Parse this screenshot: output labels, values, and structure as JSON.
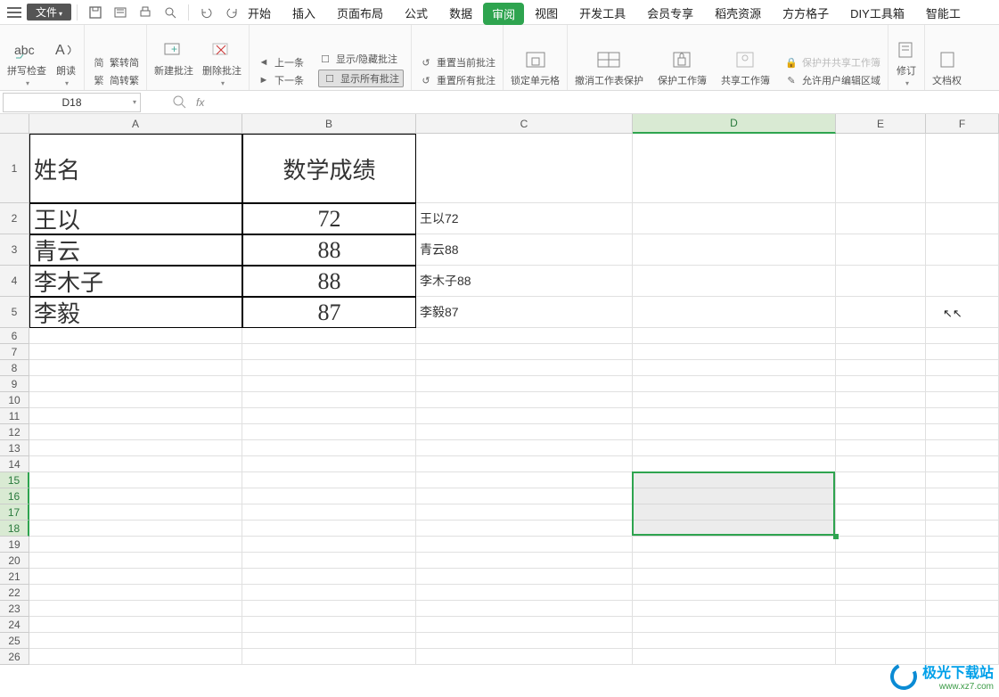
{
  "titlebar": {
    "file_label": "文件"
  },
  "ribbon_tabs": [
    "开始",
    "插入",
    "页面布局",
    "公式",
    "数据",
    "审阅",
    "视图",
    "开发工具",
    "会员专享",
    "稻壳资源",
    "方方格子",
    "DIY工具箱",
    "智能工"
  ],
  "ribbon_active_index": 5,
  "ribbon": {
    "spellcheck": "拼写检查",
    "readaloud": "朗读",
    "simp2trad": "繁转简",
    "trad2simp": "简转繁",
    "newcomment": "新建批注",
    "deletecomment": "删除批注",
    "prev": "上一条",
    "next": "下一条",
    "togglecomment": "显示/隐藏批注",
    "resetcurrent": "重置当前批注",
    "showall": "显示所有批注",
    "resetall": "重置所有批注",
    "lockcell": "锁定单元格",
    "unprotect": "撤消工作表保护",
    "protectbook": "保护工作簿",
    "sharebook": "共享工作簿",
    "protectshare": "保护并共享工作簿",
    "alloweditranges": "允许用户编辑区域",
    "revisions": "修订",
    "docauth": "文档权"
  },
  "namebox": "D18",
  "columns": [
    "A",
    "B",
    "C",
    "D",
    "E",
    "F"
  ],
  "data_rows": [
    {
      "a": "姓名",
      "b": "数学成绩",
      "c": ""
    },
    {
      "a": "王以",
      "b": "72",
      "c": "王以72"
    },
    {
      "a": "青云",
      "b": "88",
      "c": "青云88"
    },
    {
      "a": "李木子",
      "b": "88",
      "c": "李木子88"
    },
    {
      "a": "李毅",
      "b": "87",
      "c": "李毅87"
    }
  ],
  "selection": {
    "col": "D",
    "rows_from": 15,
    "rows_to": 18
  },
  "watermark": {
    "title": "极光下载站",
    "url": "www.xz7.com"
  }
}
